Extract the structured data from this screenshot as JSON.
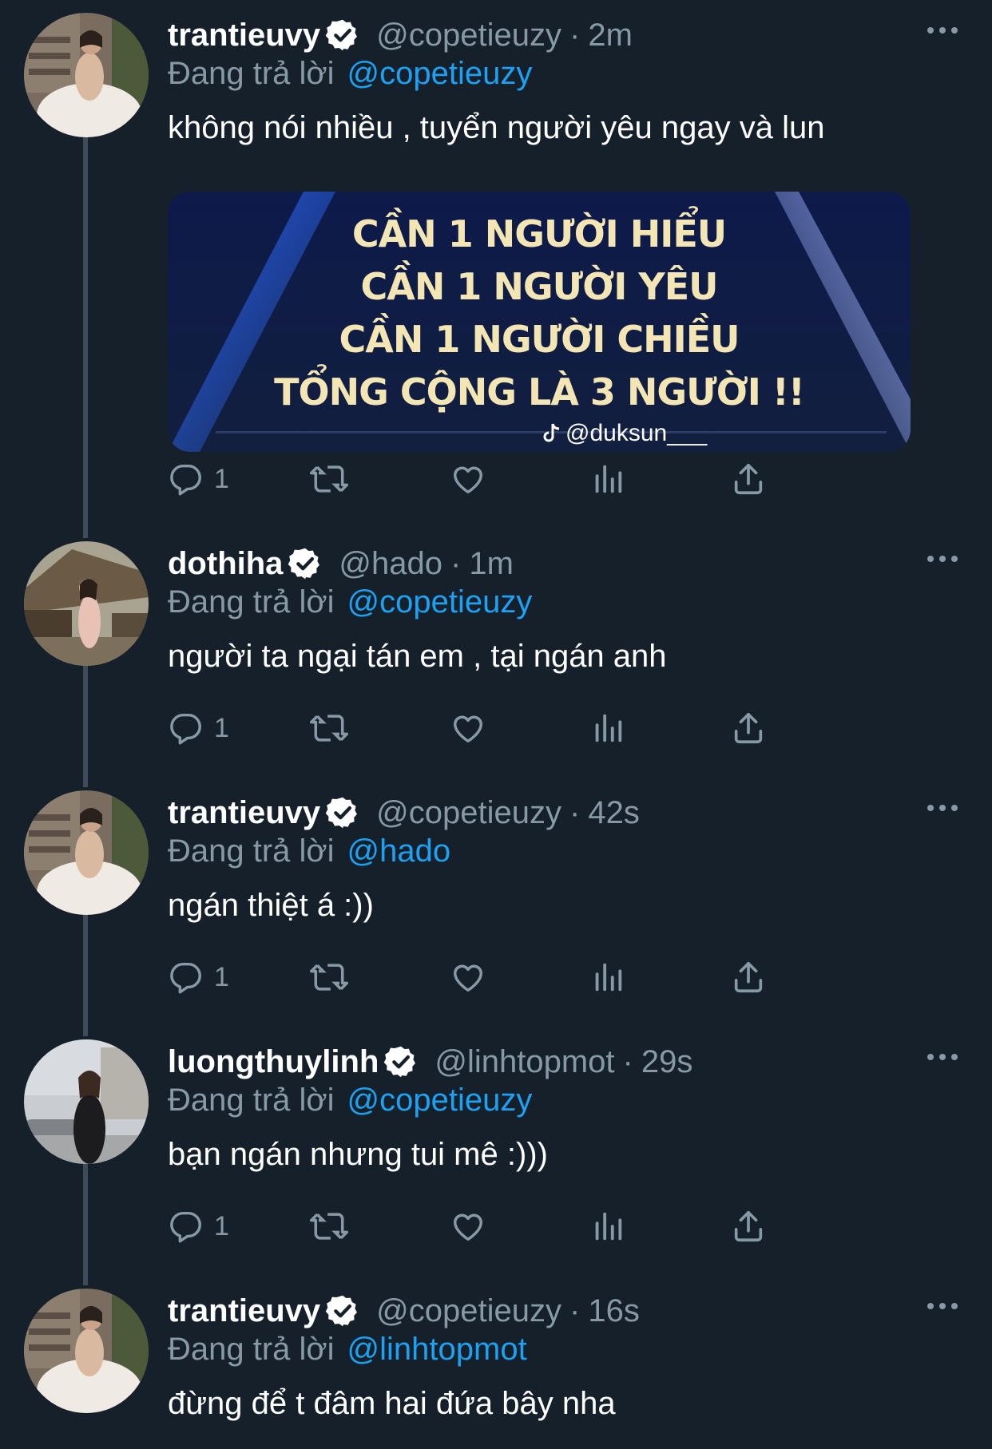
{
  "colors": {
    "background": "#15202b",
    "primary_text": "#ffffff",
    "secondary_text": "#8899a6",
    "link": "#1da1f2",
    "thread_line": "#3d4c5a",
    "verified_badge_bg": "#ffffff",
    "verified_check": "#15202b"
  },
  "reply_prefix": "Đang trả lời",
  "tweets": [
    {
      "name": "trantieuvy",
      "handle": "@copetieuzy",
      "dot": "·",
      "time": "2m",
      "reply_to": "@copetieuzy",
      "text": "không nói nhiều , tuyển người yêu ngay và lun",
      "reply_count": "1",
      "media": {
        "lines": [
          "CẦN 1 NGƯỜI HIỂU",
          "CẦN 1 NGƯỜI YÊU",
          "CẦN 1 NGƯỜI CHIỀU",
          "TỔNG CỘNG LÀ 3 NGƯỜI !!"
        ],
        "watermark": "@duksun___",
        "watermark_icon": "tiktok-icon"
      }
    },
    {
      "name": "dothiha",
      "handle": "@hado",
      "dot": "·",
      "time": "1m",
      "reply_to": "@copetieuzy",
      "text": "người ta ngại tán em , tại ngán anh",
      "reply_count": "1"
    },
    {
      "name": "trantieuvy",
      "handle": "@copetieuzy",
      "dot": "·",
      "time": "42s",
      "reply_to": "@hado",
      "text": "ngán thiệt á :))",
      "reply_count": "1"
    },
    {
      "name": "luongthuylinh",
      "handle": "@linhtopmot",
      "dot": "·",
      "time": "29s",
      "reply_to": "@copetieuzy",
      "text": "bạn ngán nhưng tui mê :)))",
      "reply_count": "1"
    },
    {
      "name": "trantieuvy",
      "handle": "@copetieuzy",
      "dot": "·",
      "time": "16s",
      "reply_to": "@linhtopmot",
      "text": "đừng để t đâm hai đứa bây nha"
    }
  ],
  "icons": {
    "reply": "reply-icon",
    "retweet": "retweet-icon",
    "like": "heart-icon",
    "views": "analytics-icon",
    "share": "share-icon",
    "more": "more-icon",
    "verified": "verified-icon"
  }
}
